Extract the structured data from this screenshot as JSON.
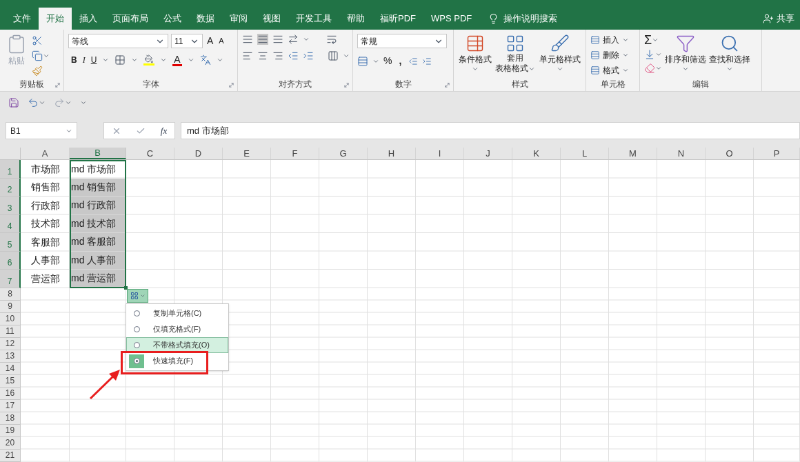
{
  "tabs": [
    {
      "label": "文件",
      "selected": false
    },
    {
      "label": "开始",
      "selected": true
    },
    {
      "label": "插入",
      "selected": false
    },
    {
      "label": "页面布局",
      "selected": false
    },
    {
      "label": "公式",
      "selected": false
    },
    {
      "label": "数据",
      "selected": false
    },
    {
      "label": "审阅",
      "selected": false
    },
    {
      "label": "视图",
      "selected": false
    },
    {
      "label": "开发工具",
      "selected": false
    },
    {
      "label": "帮助",
      "selected": false
    },
    {
      "label": "福昕PDF",
      "selected": false
    },
    {
      "label": "WPS PDF",
      "selected": false
    }
  ],
  "tell_me": "操作说明搜索",
  "share": "共享",
  "ribbon": {
    "clipboard": {
      "paste": "粘贴",
      "title": "剪贴板"
    },
    "font": {
      "font_name": "等线",
      "font_size": "11",
      "grow": "A",
      "shrink": "A",
      "styles": [
        "B",
        "I",
        "U"
      ],
      "color_letter": "A",
      "title": "字体"
    },
    "alignment": {
      "title": "对齐方式"
    },
    "number": {
      "format": "常规",
      "percent": "%",
      "comma": ",",
      "title": "数字"
    },
    "styles": {
      "conditional": "条件格式",
      "table_top": "套用",
      "table_bottom": "表格格式",
      "cell_styles": "单元格样式",
      "title": "样式"
    },
    "cells": {
      "items": [
        "插入",
        "删除",
        "格式"
      ],
      "title": "单元格"
    },
    "editing": {
      "sum": "Σ",
      "sort": "排序和筛选",
      "find": "查找和选择",
      "title": "编辑"
    }
  },
  "formula_bar": {
    "name_box": "B1",
    "fx": "fx",
    "formula": "md 市场部"
  },
  "columns": [
    {
      "label": "A",
      "selected": false
    },
    {
      "label": "B",
      "selected": true
    },
    {
      "label": "C",
      "selected": false
    },
    {
      "label": "D",
      "selected": false
    },
    {
      "label": "E",
      "selected": false
    },
    {
      "label": "F",
      "selected": false
    },
    {
      "label": "G",
      "selected": false
    },
    {
      "label": "H",
      "selected": false
    },
    {
      "label": "I",
      "selected": false
    },
    {
      "label": "J",
      "selected": false
    },
    {
      "label": "K",
      "selected": false
    },
    {
      "label": "L",
      "selected": false
    },
    {
      "label": "M",
      "selected": false
    },
    {
      "label": "N",
      "selected": false
    },
    {
      "label": "O",
      "selected": false
    },
    {
      "label": "P",
      "selected": false
    }
  ],
  "rows": [
    {
      "number": "1",
      "selected": true,
      "cells": [
        {
          "text": "市场部",
          "shaded": false
        },
        {
          "text": "md 市场部",
          "shaded": false
        }
      ]
    },
    {
      "number": "2",
      "selected": true,
      "cells": [
        {
          "text": "销售部",
          "shaded": false
        },
        {
          "text": "md 销售部",
          "shaded": true
        }
      ]
    },
    {
      "number": "3",
      "selected": true,
      "cells": [
        {
          "text": "行政部",
          "shaded": false
        },
        {
          "text": "md 行政部",
          "shaded": true
        }
      ]
    },
    {
      "number": "4",
      "selected": true,
      "cells": [
        {
          "text": "技术部",
          "shaded": false
        },
        {
          "text": "md 技术部",
          "shaded": true
        }
      ]
    },
    {
      "number": "5",
      "selected": true,
      "cells": [
        {
          "text": "客服部",
          "shaded": false
        },
        {
          "text": "md 客服部",
          "shaded": true
        }
      ]
    },
    {
      "number": "6",
      "selected": true,
      "cells": [
        {
          "text": "人事部",
          "shaded": false
        },
        {
          "text": "md 人事部",
          "shaded": true
        }
      ]
    },
    {
      "number": "7",
      "selected": true,
      "cells": [
        {
          "text": "营运部",
          "shaded": false
        },
        {
          "text": "md 营运部",
          "shaded": true
        }
      ]
    },
    {
      "number": "8",
      "selected": false,
      "cells": []
    },
    {
      "number": "9",
      "selected": false,
      "cells": []
    },
    {
      "number": "10",
      "selected": false,
      "cells": []
    },
    {
      "number": "11",
      "selected": false,
      "cells": []
    },
    {
      "number": "12",
      "selected": false,
      "cells": []
    },
    {
      "number": "13",
      "selected": false,
      "cells": []
    },
    {
      "number": "14",
      "selected": false,
      "cells": []
    },
    {
      "number": "15",
      "selected": false,
      "cells": []
    },
    {
      "number": "16",
      "selected": false,
      "cells": []
    },
    {
      "number": "17",
      "selected": false,
      "cells": []
    },
    {
      "number": "18",
      "selected": false,
      "cells": []
    },
    {
      "number": "19",
      "selected": false,
      "cells": []
    },
    {
      "number": "20",
      "selected": false,
      "cells": []
    },
    {
      "number": "21",
      "selected": false,
      "cells": []
    }
  ],
  "fill_menu": {
    "items": [
      {
        "label": "复制单元格(C)",
        "selected": false,
        "hovered": false
      },
      {
        "label": "仅填充格式(F)",
        "selected": false,
        "hovered": false
      },
      {
        "label": "不带格式填充(O)",
        "selected": false,
        "hovered": true
      },
      {
        "label": "快速填充(F)",
        "selected": true,
        "hovered": false
      }
    ]
  }
}
